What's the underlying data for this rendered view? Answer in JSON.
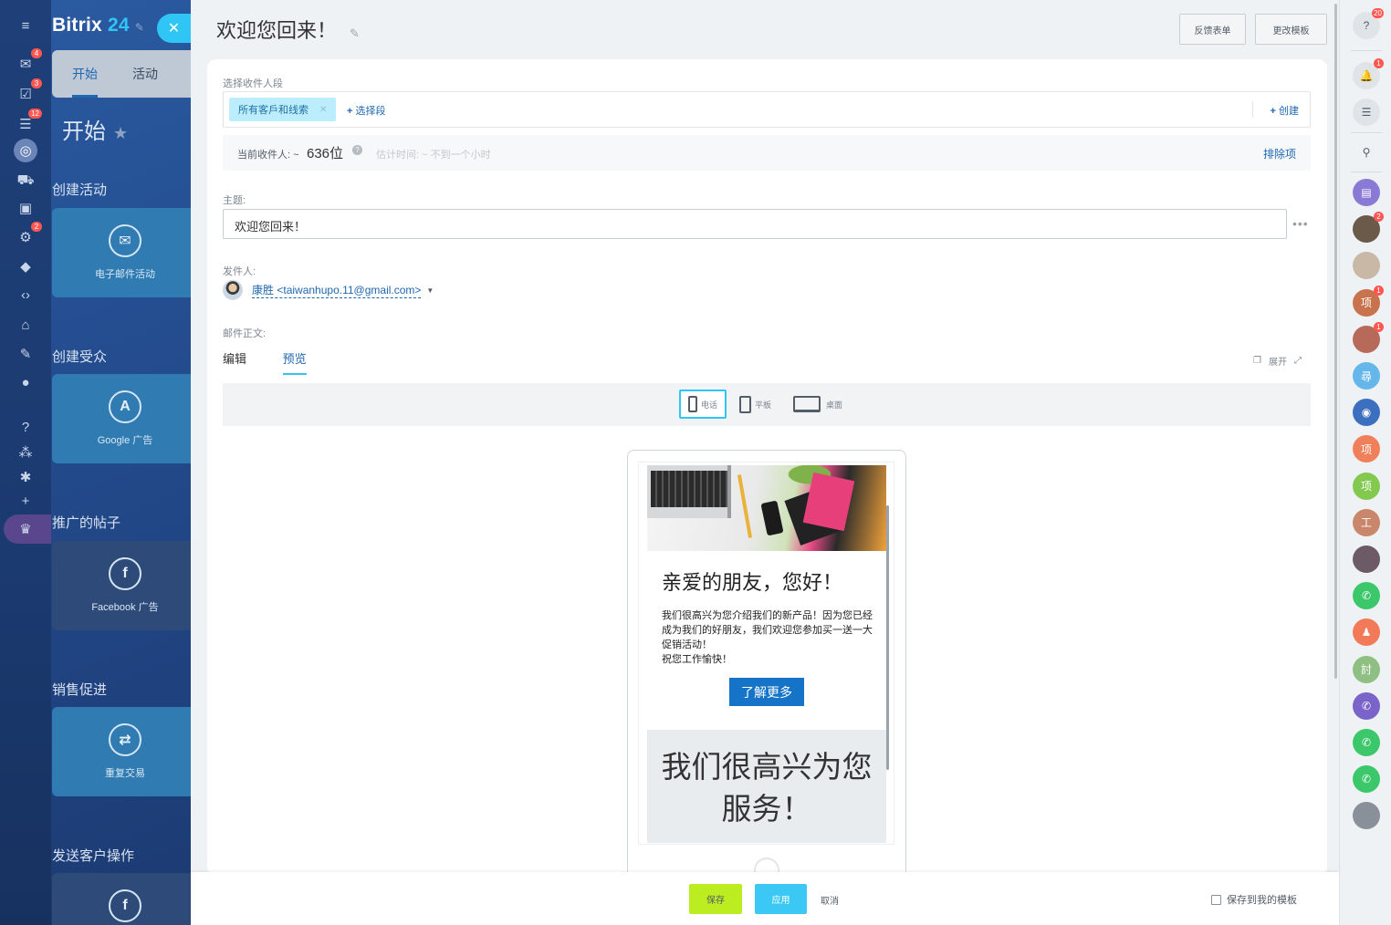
{
  "app": {
    "brand_name": "Bitrix",
    "brand_num": "24"
  },
  "left_rail": {
    "icons": [
      {
        "name": "menu-icon",
        "glyph": "≡",
        "badge": ""
      },
      {
        "name": "chat-icon",
        "glyph": "✉",
        "badge": "4"
      },
      {
        "name": "tasks-icon",
        "glyph": "☑",
        "badge": "3"
      },
      {
        "name": "filter-icon",
        "glyph": "☰",
        "badge": "12"
      },
      {
        "name": "marketing-icon",
        "glyph": "◎",
        "badge": ""
      },
      {
        "name": "cart-icon",
        "glyph": "🛒",
        "badge": ""
      },
      {
        "name": "contacts-icon",
        "glyph": "▣",
        "badge": ""
      },
      {
        "name": "robot-icon",
        "glyph": "⚙",
        "badge": "2"
      },
      {
        "name": "box-icon",
        "glyph": "◆",
        "badge": ""
      },
      {
        "name": "code-icon",
        "glyph": "‹›",
        "badge": ""
      },
      {
        "name": "building-icon",
        "glyph": "⌂",
        "badge": ""
      },
      {
        "name": "sign-icon",
        "glyph": "✎",
        "badge": ""
      },
      {
        "name": "check-icon",
        "glyph": "●",
        "badge": ""
      },
      {
        "name": "help-icon",
        "glyph": "?",
        "badge": ""
      },
      {
        "name": "org-icon",
        "glyph": "⁂",
        "badge": ""
      },
      {
        "name": "settings-icon",
        "glyph": "✱",
        "badge": ""
      },
      {
        "name": "plus-icon",
        "glyph": "+",
        "badge": ""
      },
      {
        "name": "crown-icon",
        "glyph": "♛",
        "badge": ""
      }
    ]
  },
  "bg_panel": {
    "tabs": [
      "开始",
      "活动"
    ],
    "title": "开始",
    "sections": [
      {
        "title": "创建活动",
        "card": "电子邮件活动",
        "icon": "✉"
      },
      {
        "title": "创建受众",
        "card": "Google 广告",
        "icon": "A"
      },
      {
        "title": "推广的帖子",
        "card": "Facebook 广告",
        "icon": "f"
      },
      {
        "title": "销售促进",
        "card": "重复交易",
        "icon": "⇄"
      },
      {
        "title": "发送客户操作",
        "card": "",
        "icon": "f"
      }
    ]
  },
  "slider": {
    "title": "欢迎您回来！",
    "btn_feedback": "反馈表单",
    "btn_change_template": "更改模板",
    "segment_label": "选择收件人段",
    "segment_chip": "所有客戶和线索",
    "select_segment": "选择段",
    "create": "创建",
    "recipients_label": "当前收件人: ~",
    "recipients_value": "636位",
    "estimate": "估计时间: ~ 不到一个小时",
    "exclude": "排除项",
    "subject_label": "主题:",
    "subject_value": "欢迎您回来！",
    "sender_label": "发件人:",
    "sender_name": "康胜",
    "sender_email": "<taiwanhupo.11@gmail.com>",
    "body_label": "邮件正文:",
    "tab_edit": "编辑",
    "tab_preview": "预览",
    "expand": "展开",
    "devices": [
      "电话",
      "平板",
      "桌面"
    ]
  },
  "preview": {
    "greeting": "亲爱的朋友，您好！",
    "body_lines": [
      "我们很高兴为您介绍我们的新产品！因为您已经成为我们的好朋友，我们欢迎您参加买一送一大促销活动！",
      "祝您工作愉快！"
    ],
    "cta": "了解更多",
    "banner_line1": "我们很高兴为您",
    "banner_line2": "服务！"
  },
  "footer": {
    "save": "保存",
    "apply": "应用",
    "cancel": "取消",
    "save_template": "保存到我的模板"
  },
  "right_rail": {
    "help_badge": "20",
    "bell_badge": "1",
    "contacts": [
      {
        "color": "#8a7ad6",
        "label": "▤",
        "badge": ""
      },
      {
        "color": "#6b5a4a",
        "label": "",
        "badge": "2"
      },
      {
        "color": "#c9b8a6",
        "label": "",
        "badge": ""
      },
      {
        "color": "#c8734d",
        "label": "项",
        "badge": "1"
      },
      {
        "color": "#b86a5a",
        "label": "",
        "badge": "1"
      },
      {
        "color": "#65b6ea",
        "label": "尋",
        "badge": ""
      },
      {
        "color": "#3c6fc0",
        "label": "◉",
        "badge": ""
      },
      {
        "color": "#f0805a",
        "label": "项",
        "badge": ""
      },
      {
        "color": "#84c94f",
        "label": "项",
        "badge": ""
      },
      {
        "color": "#c9866a",
        "label": "工",
        "badge": ""
      },
      {
        "color": "#6c5a66",
        "label": "",
        "badge": ""
      },
      {
        "color": "#3cc86a",
        "label": "✆",
        "badge": ""
      },
      {
        "color": "#f27a58",
        "label": "♟",
        "badge": ""
      },
      {
        "color": "#8fbf82",
        "label": "討",
        "badge": ""
      },
      {
        "color": "#7a63c9",
        "label": "✆",
        "badge": ""
      },
      {
        "color": "#3cc86a",
        "label": "✆",
        "badge": ""
      },
      {
        "color": "#3cc86a",
        "label": "✆",
        "badge": ""
      },
      {
        "color": "#8a9099",
        "label": "",
        "badge": ""
      }
    ]
  }
}
